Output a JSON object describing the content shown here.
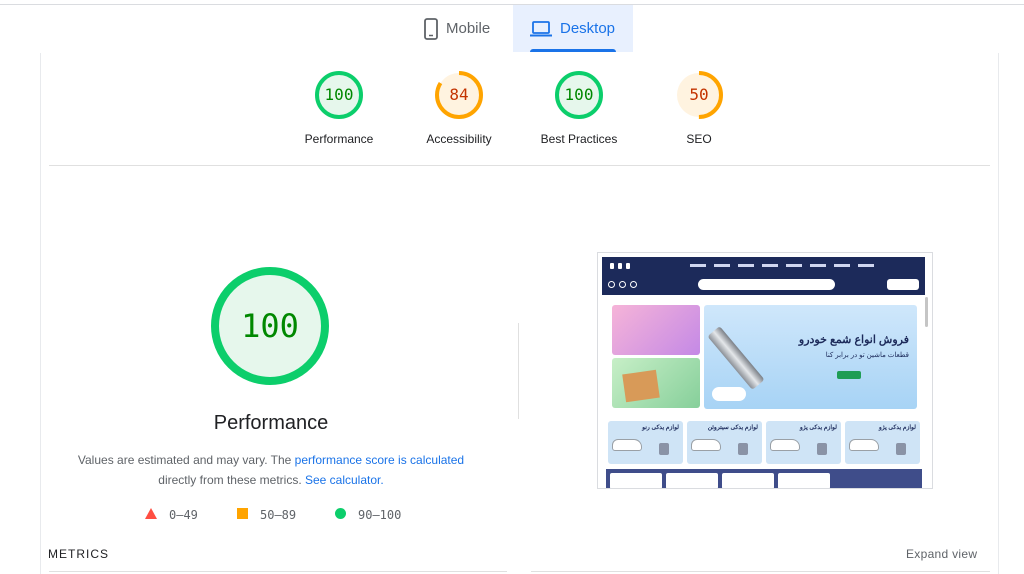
{
  "tabs": [
    {
      "label": "Mobile",
      "icon": "phone-icon",
      "selected": false
    },
    {
      "label": "Desktop",
      "icon": "laptop-icon",
      "selected": true
    }
  ],
  "categories": [
    {
      "label": "Performance",
      "score": "100",
      "value": 100,
      "rating": "pass"
    },
    {
      "label": "Accessibility",
      "score": "84",
      "value": 84,
      "rating": "average"
    },
    {
      "label": "Best Practices",
      "score": "100",
      "value": 100,
      "rating": "pass"
    },
    {
      "label": "SEO",
      "score": "50",
      "value": 50,
      "rating": "average"
    }
  ],
  "colors": {
    "pass": "#0cce6b",
    "pass_text": "#008800",
    "pass_fill": "#e6f7ec",
    "average": "#ffa400",
    "average_text": "#c33300",
    "average_fill": "#fff3e0",
    "fail": "#ff4e42",
    "link": "#1a73e8",
    "tab_selected": "#1a73e8"
  },
  "main": {
    "score": "100",
    "value": 100,
    "title": "Performance",
    "desc_1": "Values are estimated and may vary. The ",
    "desc_link_1": "performance score is calculated",
    "desc_2": " directly from these metrics. ",
    "desc_link_2": "See calculator."
  },
  "legend": [
    {
      "range": "0–49",
      "shape": "triangle",
      "rating": "fail"
    },
    {
      "range": "50–89",
      "shape": "square",
      "rating": "average"
    },
    {
      "range": "90–100",
      "shape": "circle",
      "rating": "pass"
    }
  ],
  "screenshot": {
    "hero_title": "فروش انواع شمع خودرو",
    "hero_subtitle": "قطعات ماشین تو در برابر کنا",
    "cards": [
      "لوازم یدکی پژو",
      "لوازم یدکی سیتروئن",
      "لوازم یدکی رنو",
      "لوازم یدکی پژو"
    ]
  },
  "metrics_label": "METRICS",
  "expand_label": "Expand view"
}
